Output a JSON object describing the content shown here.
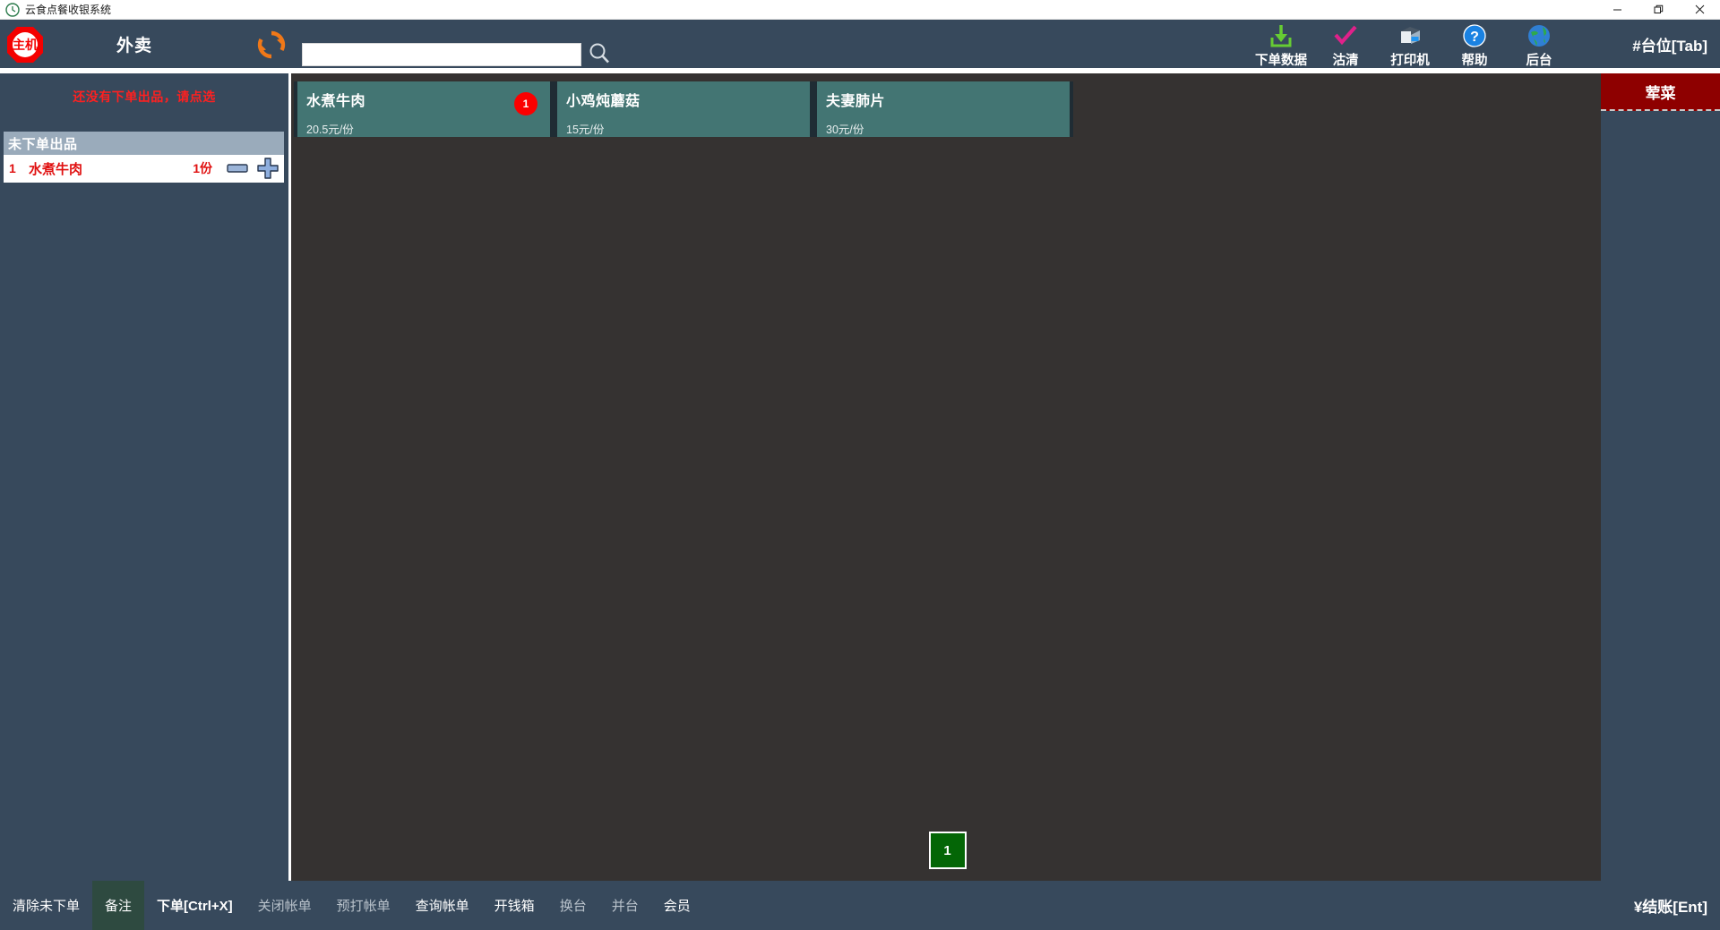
{
  "window": {
    "title": "云食点餐收银系统",
    "app_icon": "clock-logo-icon",
    "minimize": "—",
    "maximize": "❐",
    "close": "✕"
  },
  "header": {
    "logo_text": "主机",
    "mode_label": "外卖",
    "refresh_icon": "refresh-icon",
    "search": {
      "value": "",
      "placeholder": ""
    },
    "search_icon": "search-icon",
    "tools": [
      {
        "label": "下单数据",
        "icon": "download-data-icon",
        "color": "#66cc33"
      },
      {
        "label": "沽清",
        "icon": "sold-out-check-icon",
        "color": "#e0218a"
      },
      {
        "label": "打印机",
        "icon": "printer-icon",
        "color": "#b8c6d4"
      },
      {
        "label": "帮助",
        "icon": "help-question-icon",
        "color": "#1a82e2"
      },
      {
        "label": "后台",
        "icon": "globe-backend-icon",
        "color": "#2f7fd4"
      }
    ],
    "table_indicator": "#台位[Tab]"
  },
  "order_panel": {
    "empty_message": "还没有下单出品，请点选",
    "list_header": "未下单出品",
    "rows": [
      {
        "index": "1",
        "name": "水煮牛肉",
        "qty": "1份",
        "minus_icon": "minus-button-icon",
        "plus_icon": "plus-button-icon"
      }
    ]
  },
  "dishes": [
    {
      "name": "水煮牛肉",
      "price": "20.5元/份",
      "badge": "1"
    },
    {
      "name": "小鸡炖蘑菇",
      "price": "15元/份",
      "badge": ""
    },
    {
      "name": "夫妻肺片",
      "price": "30元/份",
      "badge": ""
    }
  ],
  "pagination": {
    "pages": [
      "1"
    ],
    "current": "1"
  },
  "categories": [
    {
      "label": "荤菜",
      "color": "#8e0000"
    }
  ],
  "footer": {
    "buttons": [
      {
        "label": "清除未下单",
        "state": "normal"
      },
      {
        "label": "备注",
        "state": "active"
      },
      {
        "label": "下单[Ctrl+X]",
        "state": "bold"
      },
      {
        "label": "关闭帐单",
        "state": "dim"
      },
      {
        "label": "预打帐单",
        "state": "dim"
      },
      {
        "label": "查询帐单",
        "state": "normal"
      },
      {
        "label": "开钱箱",
        "state": "normal"
      },
      {
        "label": "换台",
        "state": "dim"
      },
      {
        "label": "并台",
        "state": "dim"
      },
      {
        "label": "会员",
        "state": "normal"
      }
    ],
    "checkout": "¥结账[Ent]"
  },
  "colors": {
    "header_bg": "#37495c",
    "content_bg": "#353231",
    "dish_card": "#437573",
    "badge_red": "#fb0000",
    "category_red": "#8e0000",
    "page_green": "#046606",
    "accent_orange": "#f07818",
    "alert_red": "#ff2020"
  }
}
